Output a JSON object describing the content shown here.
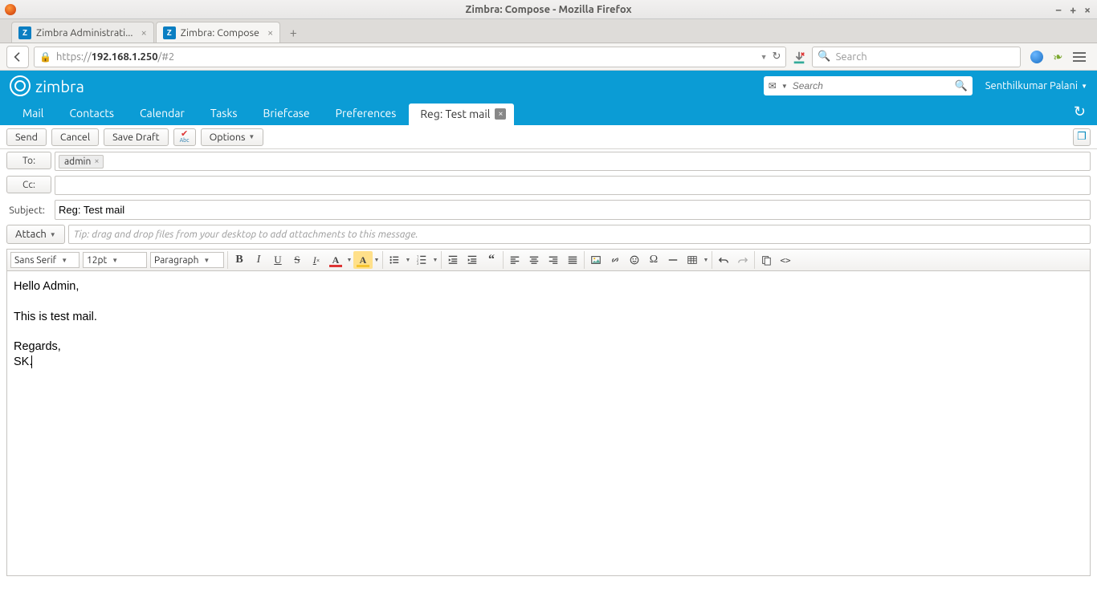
{
  "window": {
    "title": "Zimbra: Compose - Mozilla Firefox",
    "btns": {
      "min": "−",
      "max": "+",
      "close": "×"
    }
  },
  "browser_tabs": [
    {
      "label": "Zimbra Administrati..."
    },
    {
      "label": "Zimbra: Compose"
    }
  ],
  "newtab": "+",
  "url": {
    "proto": "https://",
    "host": "192.168.1.250",
    "path": "/#2"
  },
  "search_placeholder": "Search",
  "zimbra": {
    "brand": "zimbra",
    "search_placeholder": "Search",
    "user": "Senthilkumar Palani"
  },
  "nav": {
    "items": [
      "Mail",
      "Contacts",
      "Calendar",
      "Tasks",
      "Briefcase",
      "Preferences"
    ],
    "active_tab": "Reg: Test mail"
  },
  "toolbar": {
    "send": "Send",
    "cancel": "Cancel",
    "save_draft": "Save Draft",
    "options": "Options"
  },
  "compose": {
    "to_label": "To:",
    "to_chip": "admin",
    "cc_label": "Cc:",
    "subject_label": "Subject:",
    "subject_value": "Reg: Test mail",
    "attach_label": "Attach",
    "attach_tip": "Tip: drag and drop files from your desktop to add attachments to this message."
  },
  "editor": {
    "font": "Sans Serif",
    "size": "12pt",
    "format": "Paragraph"
  },
  "body": {
    "l1": "Hello Admin,",
    "l2": "This is test mail.",
    "l3": "Regards,",
    "l4": "SK."
  }
}
